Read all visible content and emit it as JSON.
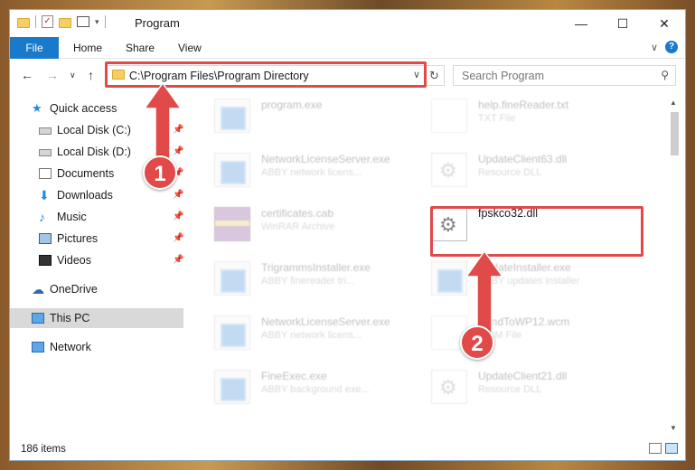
{
  "window": {
    "title": "Program",
    "controls": {
      "minimize": "—",
      "maximize": "☐",
      "close": "✕"
    }
  },
  "ribbon": {
    "tabs": [
      "File",
      "Home",
      "Share",
      "View"
    ],
    "expand": "∨",
    "help": "?"
  },
  "nav": {
    "back": "←",
    "forward": "→",
    "recent": "∨",
    "up": "↑"
  },
  "address": {
    "path": "C:\\Program Files\\Program Directory",
    "dropdown": "∨",
    "refresh": "↻"
  },
  "search": {
    "placeholder": "Search Program",
    "icon": "⚲"
  },
  "sidebar": {
    "items": [
      {
        "label": "Quick access",
        "icon": "star-icon",
        "pinned": false
      },
      {
        "label": "Local Disk (C:)",
        "icon": "drive-icon",
        "pinned": true
      },
      {
        "label": "Local Disk (D:)",
        "icon": "drive-icon",
        "pinned": true
      },
      {
        "label": "Documents",
        "icon": "documents-icon",
        "pinned": true
      },
      {
        "label": "Downloads",
        "icon": "downloads-icon",
        "pinned": true
      },
      {
        "label": "Music",
        "icon": "music-icon",
        "pinned": true
      },
      {
        "label": "Pictures",
        "icon": "pictures-icon",
        "pinned": true
      },
      {
        "label": "Videos",
        "icon": "videos-icon",
        "pinned": true
      },
      {
        "label": "OneDrive",
        "icon": "onedrive-icon",
        "pinned": false
      },
      {
        "label": "This PC",
        "icon": "pc-icon",
        "pinned": false,
        "selected": true
      },
      {
        "label": "Network",
        "icon": "network-icon",
        "pinned": false
      }
    ],
    "pin_glyph": "📌"
  },
  "files": [
    {
      "name": "program.exe",
      "type": "",
      "icon": "exe-icon",
      "faded": true
    },
    {
      "name": "help.fineReader.txt",
      "type": "TXT File",
      "icon": "doc-icon",
      "faded": true
    },
    {
      "name": "NetworkLicenseServer.exe",
      "type": "ABBY network licens...",
      "icon": "exe-icon",
      "faded": true
    },
    {
      "name": "UpdateClient63.dll",
      "type": "Resource DLL",
      "icon": "dll-icon",
      "faded": true
    },
    {
      "name": "certificates.cab",
      "type": "WinRAR Archive",
      "icon": "cab-icon",
      "faded": true
    },
    {
      "name": "fpskco32.dll",
      "type": "",
      "icon": "dll-icon",
      "faded": false
    },
    {
      "name": "TrigrammsInstaller.exe",
      "type": "ABBY finereader tri...",
      "icon": "exe-icon",
      "faded": true
    },
    {
      "name": "UpdateInstaller.exe",
      "type": "ABBY updates installer",
      "icon": "exe-icon",
      "faded": true
    },
    {
      "name": "NetworkLicenseServer.exe",
      "type": "ABBY network licens...",
      "icon": "exe-icon",
      "faded": true
    },
    {
      "name": "SendToWP12.wcm",
      "type": "WCM File",
      "icon": "doc-icon",
      "faded": true
    },
    {
      "name": "FineExec.exe",
      "type": "ABBY background exe...",
      "icon": "exe-icon",
      "faded": true
    },
    {
      "name": "UpdateClient21.dll",
      "type": "Resource DLL",
      "icon": "dll-icon",
      "faded": true
    }
  ],
  "annotations": {
    "badge1": "1",
    "badge2": "2",
    "color": "#e04a48"
  },
  "status": {
    "count": "186 items"
  },
  "colors": {
    "accent": "#1979ca",
    "selection": "#d9d9d9"
  }
}
